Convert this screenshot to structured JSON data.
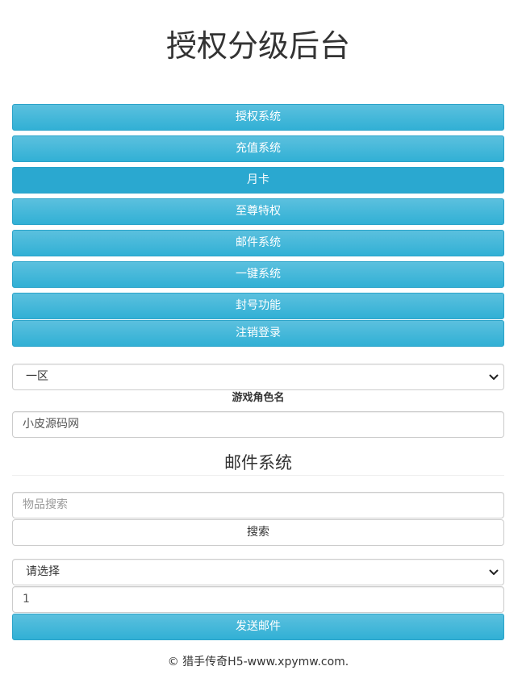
{
  "header": {
    "title": "授权分级后台"
  },
  "menu": {
    "items": [
      {
        "label": "授权系统"
      },
      {
        "label": "充值系统"
      },
      {
        "label": "月卡"
      },
      {
        "label": "至尊特权"
      },
      {
        "label": "邮件系统"
      },
      {
        "label": "一键系统"
      },
      {
        "label": "封号功能"
      },
      {
        "label": "注销登录"
      }
    ]
  },
  "server_select": {
    "value": "一区"
  },
  "role": {
    "label": "游戏角色名",
    "value": "小皮源码网"
  },
  "mail": {
    "title": "邮件系统",
    "search_placeholder": "物品搜索",
    "search_button": "搜索",
    "item_select_value": "请选择",
    "quantity_value": "1",
    "send_button": "发送邮件"
  },
  "footer": {
    "text": "© 猎手传奇H5-www.xpymw.com."
  },
  "colors": {
    "info_button": "#5bc0de",
    "info_button_dark": "#31b0d5"
  }
}
